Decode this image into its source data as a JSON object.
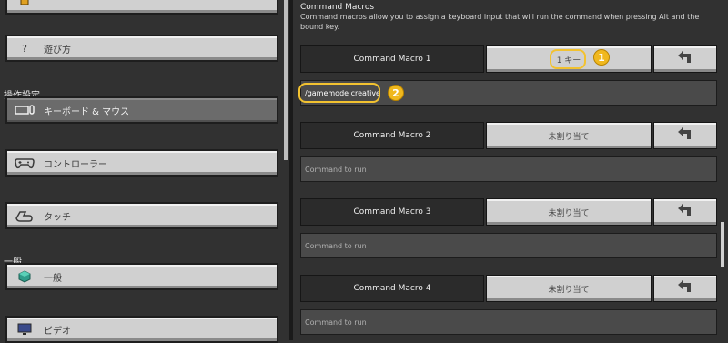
{
  "sidebar": {
    "how_to_play": {
      "icon": "question-icon",
      "symbol": "?",
      "label": "遊び方"
    },
    "controls_section": "操作設定",
    "keyboard_mouse": {
      "icon": "keyboard-mouse-icon",
      "label": "キーボード & マウス"
    },
    "controller": {
      "icon": "controller-icon",
      "label": "コントローラー"
    },
    "touch": {
      "icon": "touch-icon",
      "label": "タッチ"
    },
    "general_section": "一般",
    "general": {
      "icon": "cube-icon",
      "label": "一般"
    },
    "video": {
      "icon": "monitor-icon",
      "label": "ビデオ"
    }
  },
  "main": {
    "title": "Command Macros",
    "description": "Command macros allow you to assign a keyboard input that will run the command when pressing Alt and the bound key.",
    "macros": [
      {
        "name": "Command Macro 1",
        "key": "1 キー",
        "command": "/gamemode creative",
        "placeholder": "Command to run"
      },
      {
        "name": "Command Macro 2",
        "key": "未割り当て",
        "command": "",
        "placeholder": "Command to run"
      },
      {
        "name": "Command Macro 3",
        "key": "未割り当て",
        "command": "",
        "placeholder": "Command to run"
      },
      {
        "name": "Command Macro 4",
        "key": "未割り当て",
        "command": "",
        "placeholder": "Command to run"
      }
    ]
  },
  "annotations": {
    "badge_1": "1",
    "badge_2": "2"
  },
  "colors": {
    "accent": "#f2c230",
    "panel": "#313131",
    "button": "#d0d0d0"
  }
}
